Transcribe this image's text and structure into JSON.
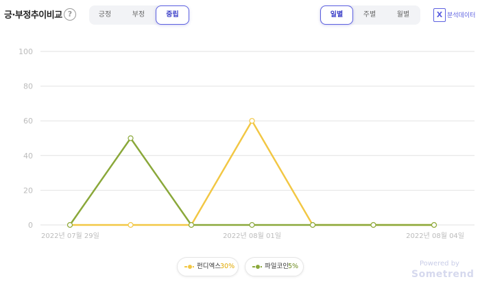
{
  "header": {
    "title": "긍·부정추이비교",
    "help": "?",
    "sentiment_tabs": [
      "긍정",
      "부정",
      "중립"
    ],
    "sentiment_active": 2,
    "period_tabs": [
      "일별",
      "주별",
      "월별"
    ],
    "period_active": 0,
    "excel_label": "분석데이터",
    "excel_icon_text": "X"
  },
  "footer": {
    "powered": "Powered by",
    "brand": "Sometrend"
  },
  "colors": {
    "series0": "#f2c744",
    "series1": "#8aa83a",
    "grid": "#e2e2e2",
    "tick": "#bbbbbb"
  },
  "chart_data": {
    "type": "line",
    "x": [
      "2022-07-29",
      "2022-07-30",
      "2022-07-31",
      "2022-08-01",
      "2022-08-02",
      "2022-08-03",
      "2022-08-04"
    ],
    "xtick_labels": [
      {
        "index": 0,
        "label": "2022년 07월 29일"
      },
      {
        "index": 3,
        "label": "2022년 08월 01일"
      },
      {
        "index": 6,
        "label": "2022년 08월 04일"
      }
    ],
    "ylim": [
      0,
      100
    ],
    "yticks": [
      "0",
      "20",
      "40",
      "60",
      "80",
      "100"
    ],
    "grid": true,
    "legend_position": "bottom",
    "series": [
      {
        "name": "펀디엑스",
        "percent": "30%",
        "values": [
          0,
          0,
          0,
          60,
          0,
          0,
          0
        ]
      },
      {
        "name": "파일코인",
        "percent": "5%",
        "values": [
          0,
          50,
          0,
          0,
          0,
          0,
          0
        ]
      }
    ]
  }
}
